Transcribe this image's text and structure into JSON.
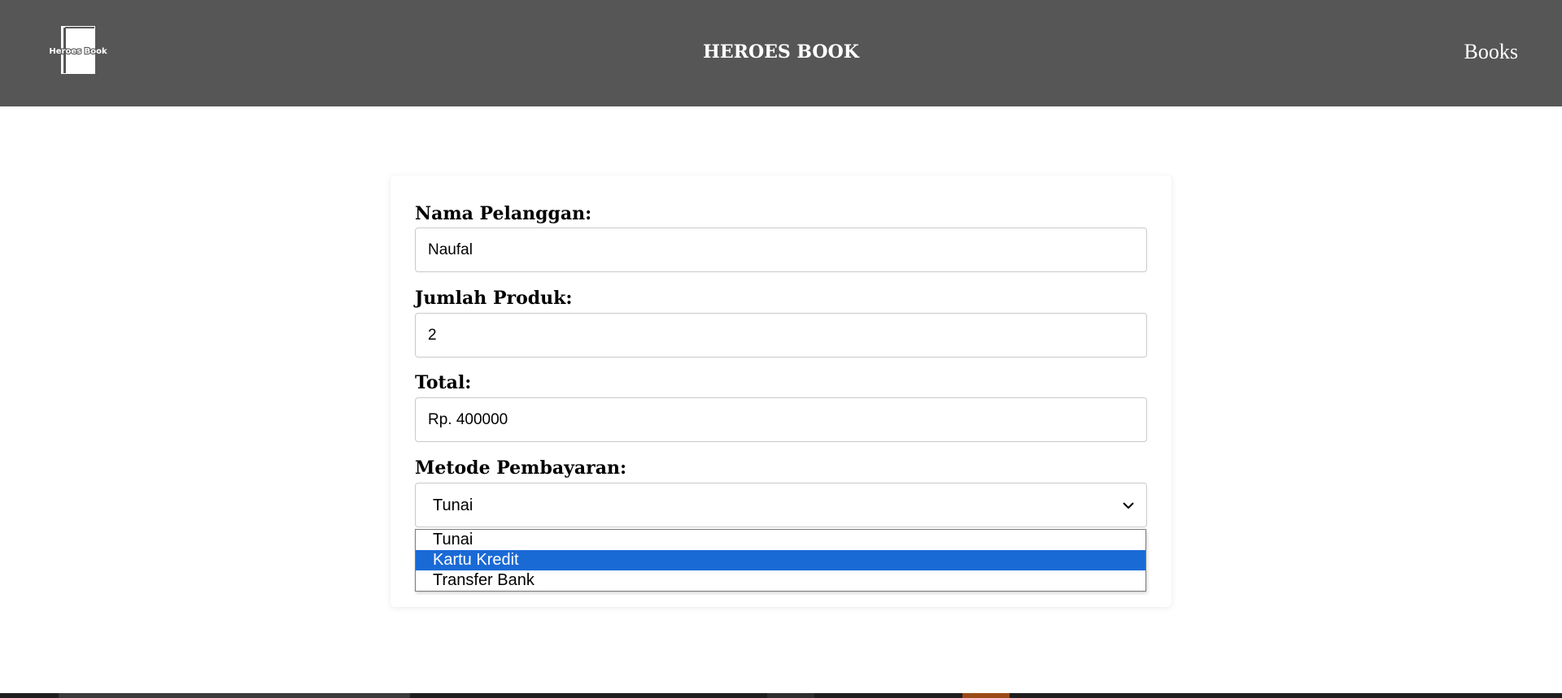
{
  "header": {
    "logo_text": "Heroes Book",
    "title": "HEROES BOOK",
    "nav_books": "Books"
  },
  "form": {
    "customer_name": {
      "label": "Nama Pelanggan:",
      "value": "Naufal"
    },
    "product_qty": {
      "label": "Jumlah Produk:",
      "value": "2"
    },
    "total": {
      "label": "Total:",
      "value": "Rp. 400000"
    },
    "payment_method": {
      "label": "Metode Pembayaran:",
      "selected": "Tunai",
      "options": [
        "Tunai",
        "Kartu Kredit",
        "Transfer Bank"
      ],
      "highlighted_option": "Kartu Kredit"
    }
  },
  "colors": {
    "header_bg": "#565656",
    "highlight": "#1a6ad6"
  }
}
